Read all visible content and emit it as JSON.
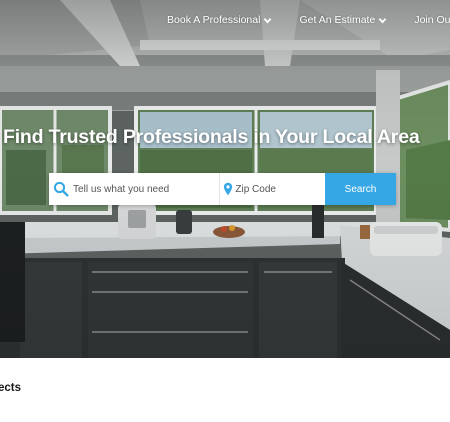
{
  "nav": {
    "items": [
      {
        "label": "Book A Professional",
        "has_dropdown": true
      },
      {
        "label": "Get An Estimate",
        "has_dropdown": true
      },
      {
        "label": "Join Our",
        "has_dropdown": false
      }
    ]
  },
  "hero": {
    "headline": "Find Trusted Professionals in Your Local Area"
  },
  "search": {
    "service_placeholder": "Tell us what you need",
    "zip_placeholder": "Zip Code",
    "button_label": "Search"
  },
  "section": {
    "heading": "ects"
  },
  "colors": {
    "accent": "#36a7e5",
    "text_dark": "#1a1a1a",
    "white": "#ffffff"
  },
  "icons": {
    "service": "search-icon",
    "zip": "map-pin-icon",
    "dropdown": "chevron-down-icon"
  }
}
